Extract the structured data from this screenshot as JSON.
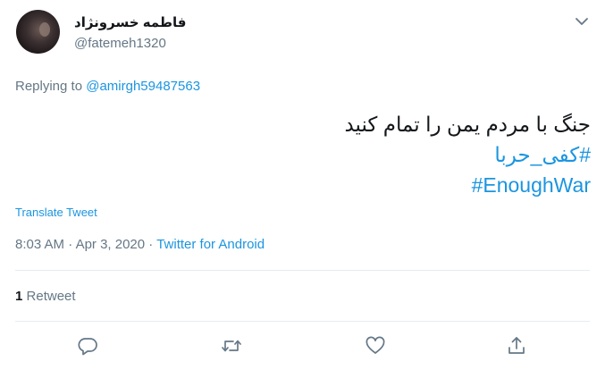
{
  "author": {
    "display_name": "فاطمه خسرونژاد",
    "handle": "@fatemeh1320"
  },
  "reply": {
    "prefix": "Replying to",
    "to": "@amirgh59487563"
  },
  "tweet": {
    "text_line1": "جنگ با مردم یمن را تمام کنید",
    "hashtag1": "#کفی_حربا",
    "hashtag2": "#EnoughWar"
  },
  "translate_label": "Translate Tweet",
  "meta": {
    "time": "8:03 AM",
    "separator1": "·",
    "date": "Apr 3, 2020",
    "separator2": "·",
    "source": "Twitter for Android"
  },
  "stats": {
    "retweet_count": "1",
    "retweet_label": "Retweet"
  },
  "icons": {
    "reply": "reply-icon",
    "retweet": "retweet-icon",
    "like": "like-icon",
    "share": "share-icon",
    "menu": "chevron-down-icon"
  },
  "colors": {
    "link": "#1b95e0",
    "muted": "#657786",
    "text": "#14171a"
  }
}
